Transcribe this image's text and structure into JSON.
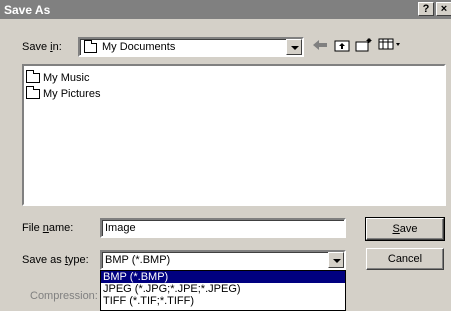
{
  "window": {
    "title": "Save As",
    "help_label": "?",
    "close_label": "×"
  },
  "save_in": {
    "label_prefix": "Save ",
    "label_accel": "i",
    "label_suffix": "n:",
    "value": "My Documents"
  },
  "toolbar": {
    "back_icon": "back-arrow-icon",
    "up_icon": "up-folder-icon",
    "new_folder_icon": "new-folder-icon",
    "view_menu_icon": "view-menu-icon"
  },
  "files": [
    {
      "name": "My Music",
      "icon": "folder-icon"
    },
    {
      "name": "My Pictures",
      "icon": "pictures-folder-icon"
    }
  ],
  "file_name": {
    "label_prefix": "File ",
    "label_accel": "n",
    "label_suffix": "ame:",
    "value": "Image"
  },
  "save_as_type": {
    "label_prefix": "Save as ",
    "label_accel": "t",
    "label_suffix": "ype:",
    "value": "BMP (*.BMP)",
    "options": [
      "BMP (*.BMP)",
      "JPEG (*.JPG;*.JPE;*.JPEG)",
      "TIFF (*.TIF;*.TIFF)"
    ]
  },
  "compression": {
    "label": "Compression:"
  },
  "buttons": {
    "save_accel": "S",
    "save_rest": "ave",
    "cancel": "Cancel"
  },
  "colors": {
    "title_bar": "#808080",
    "dialog_face": "#d4d0c8",
    "selection": "#000080"
  }
}
